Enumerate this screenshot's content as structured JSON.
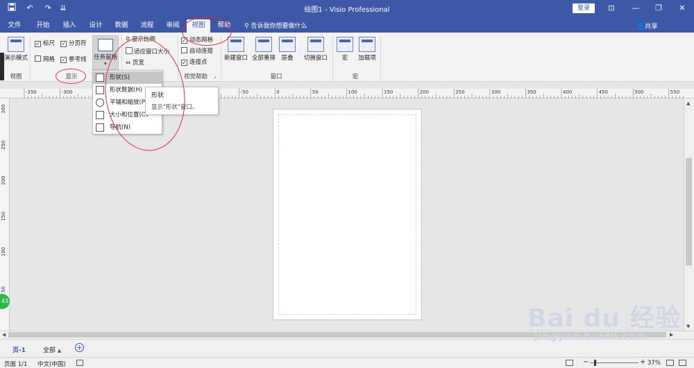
{
  "titlebar": {
    "title": "绘图1 - Visio Professional",
    "login": "登录",
    "save_icon": "save-icon",
    "undo_icon": "undo-icon",
    "redo_icon": "redo-icon",
    "customize_icon": "customize-icon",
    "min_glyph": "—",
    "max_glyph": "❐",
    "close_glyph": "✕",
    "ribbon_display_glyph": "⊡"
  },
  "tabs": [
    "文件",
    "开始",
    "插入",
    "设计",
    "数据",
    "流程",
    "审阅",
    "视图",
    "帮助"
  ],
  "active_tab": "视图",
  "tellme": "告诉我你想要做什么",
  "share": "共享",
  "ribbon": {
    "view_group": {
      "label": "视图",
      "present_mode": "演示模式"
    },
    "show_group": {
      "label": "显示",
      "ruler": "标尺",
      "pagebreak": "分页符",
      "grid": "网格",
      "guides": "参考线",
      "taskpane": "任务窗格"
    },
    "zoom_group": {
      "zoom": "显示比例",
      "fit": "适应窗口大小",
      "pagewidth": "页宽"
    },
    "visual_group": {
      "label": "视觉帮助",
      "dynamic_grid": "动态网格",
      "autoconnect": "自动连接",
      "connection_points": "连接点"
    },
    "window_group": {
      "label": "窗口",
      "new_window": "新建窗口",
      "arrange_all": "全部重排",
      "cascade": "层叠",
      "switch_window": "切换窗口"
    },
    "macro_group": {
      "label": "宏",
      "macro": "宏",
      "addins": "加载项"
    }
  },
  "dropdown": {
    "items": [
      "形状(S)",
      "形状数据(H)",
      "平铺和缩放(P)",
      "大小和位置(O)",
      "导航(N)"
    ]
  },
  "tooltip": {
    "title": "形状",
    "desc": "显示\"形状\"窗口。"
  },
  "hruler_labels": [
    "-350",
    "-300",
    "-250",
    "-200",
    "-150",
    "-100",
    "-50",
    "0",
    "50",
    "100",
    "150",
    "200",
    "250",
    "300",
    "350",
    "400",
    "450",
    "500",
    "550"
  ],
  "vruler_labels": [
    "300",
    "250",
    "200",
    "150",
    "100",
    "50"
  ],
  "pagetabs": {
    "page": "页-1",
    "all": "全部",
    "add": "+"
  },
  "status": {
    "page": "页面 1/1",
    "lang": "中文(中国)",
    "zoom": "37%"
  },
  "watermark": {
    "brand": "Bai du 经验",
    "url": "jingyan.baidu.com"
  },
  "badge": "43",
  "colors": {
    "titlebar": "#3c59a8",
    "annotation": "#e0283a",
    "ribbon": "#f3f3f3"
  }
}
